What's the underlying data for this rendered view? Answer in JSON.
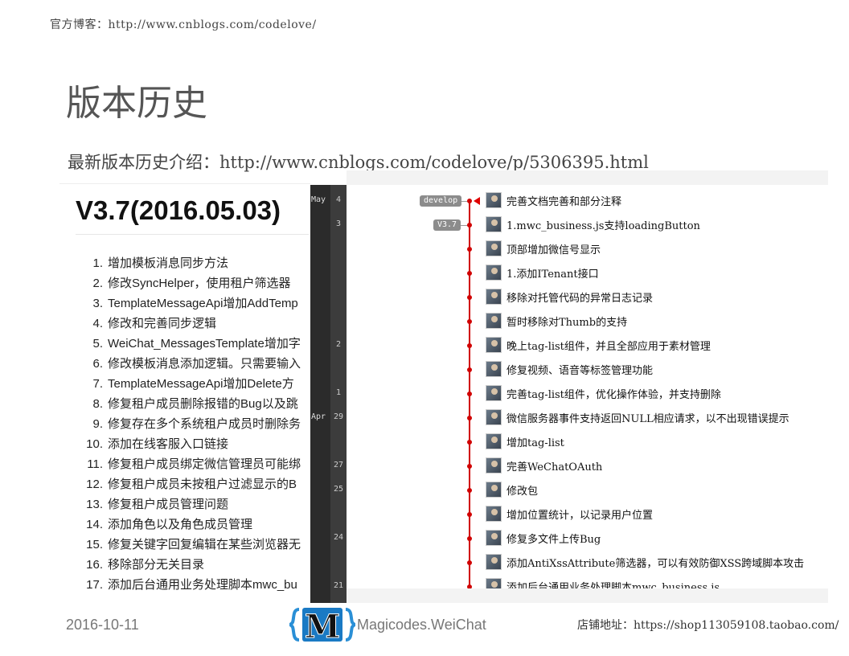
{
  "header": {
    "blog_line": "官方博客：http://www.cnblogs.com/codelove/",
    "title": "版本历史",
    "subtitle": "最新版本历史介绍：http://www.cnblogs.com/codelove/p/5306395.html"
  },
  "changelog": {
    "version": "V3.7(2016.05.03)",
    "items": [
      {
        "num": "1.",
        "text": "增加模板消息同步方法"
      },
      {
        "num": "2.",
        "text": "修改SyncHelper，使用租户筛选器"
      },
      {
        "num": "3.",
        "text": "TemplateMessageApi增加AddTemp"
      },
      {
        "num": "4.",
        "text": "修改和完善同步逻辑"
      },
      {
        "num": "5.",
        "text": "WeiChat_MessagesTemplate增加字"
      },
      {
        "num": "6.",
        "text": "修改模板消息添加逻辑。只需要输入"
      },
      {
        "num": "7.",
        "text": "TemplateMessageApi增加Delete方"
      },
      {
        "num": "8.",
        "text": "修复租户成员删除报错的Bug以及跳"
      },
      {
        "num": "9.",
        "text": "修复存在多个系统租户成员时删除务"
      },
      {
        "num": "10.",
        "text": "添加在线客服入口链接"
      },
      {
        "num": "11.",
        "text": "修复租户成员绑定微信管理员可能绑"
      },
      {
        "num": "12.",
        "text": "修复租户成员未按租户过滤显示的B"
      },
      {
        "num": "13.",
        "text": "修复租户成员管理问题"
      },
      {
        "num": "14.",
        "text": "添加角色以及角色成员管理"
      },
      {
        "num": "15.",
        "text": "修复关键字回复编辑在某些浏览器无"
      },
      {
        "num": "16.",
        "text": "移除部分无关目录"
      },
      {
        "num": "17.",
        "text": "添加后台通用业务处理脚本mwc_bu"
      }
    ]
  },
  "history": {
    "months": [
      {
        "label": "May",
        "row": 0
      },
      {
        "label": "Apr",
        "row": 9
      }
    ],
    "days": [
      {
        "label": "4",
        "row": 0
      },
      {
        "label": "3",
        "row": 1
      },
      {
        "label": "2",
        "row": 6
      },
      {
        "label": "1",
        "row": 8
      },
      {
        "label": "29",
        "row": 9
      },
      {
        "label": "27",
        "row": 11
      },
      {
        "label": "25",
        "row": 12
      },
      {
        "label": "24",
        "row": 14
      },
      {
        "label": "21",
        "row": 16
      }
    ],
    "branch_tag": "develop",
    "version_tag": "V3.7",
    "line_color": "#d00000",
    "commits": [
      "完善文档完善和部分注释",
      "1.mwc_business.js支持loadingButton",
      "顶部增加微信号显示",
      "1.添加ITenant接口",
      "移除对托管代码的异常日志记录",
      "暂时移除对Thumb的支持",
      "晚上tag-list组件，并且全部应用于素材管理",
      "修复视频、语音等标签管理功能",
      "完善tag-list组件，优化操作体验，并支持删除",
      "微信服务器事件支持返回NULL相应请求，以不出现错误提示",
      "增加tag-list",
      "完善WeChatOAuth",
      "修改包",
      "增加位置统计，以记录用户位置",
      "修复多文件上传Bug",
      "添加AntiXssAttribute筛选器，可以有效防御XSS跨域脚本攻击",
      "添加后台通用业务处理脚本mwc_business.js"
    ]
  },
  "footer": {
    "date": "2016-10-11",
    "logo_letter": "M",
    "brand": "Magicodes.WeiChat",
    "shop": "店铺地址：https://shop113059108.taobao.com/"
  }
}
